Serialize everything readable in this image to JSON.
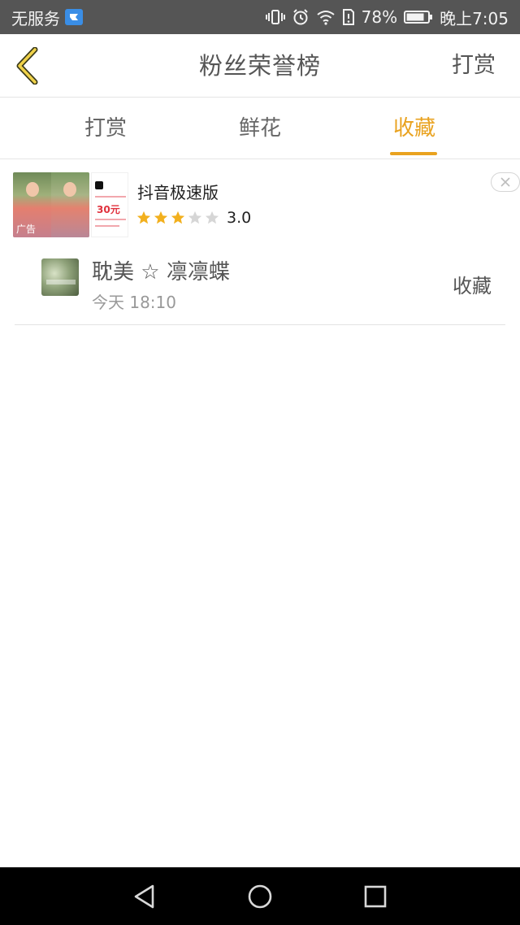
{
  "status_bar": {
    "carrier": "无服务",
    "battery_percent": "78%",
    "time": "晚上7:05"
  },
  "header": {
    "title": "粉丝荣誉榜",
    "action_label": "打赏"
  },
  "tabs": [
    {
      "label": "打赏",
      "active": false
    },
    {
      "label": "鲜花",
      "active": false
    },
    {
      "label": "收藏",
      "active": true
    }
  ],
  "ad": {
    "app_name": "抖音极速版",
    "rating": "3.0",
    "rating_stars": 3,
    "tag": "广告",
    "poster_amount": "30元"
  },
  "items": [
    {
      "name": "耽美 ☆ 凛凛蝶",
      "time": "今天 18:10",
      "action": "收藏"
    }
  ],
  "colors": {
    "accent": "#e9a21f",
    "status_bar": "#555555",
    "nav_bar": "#000000"
  }
}
